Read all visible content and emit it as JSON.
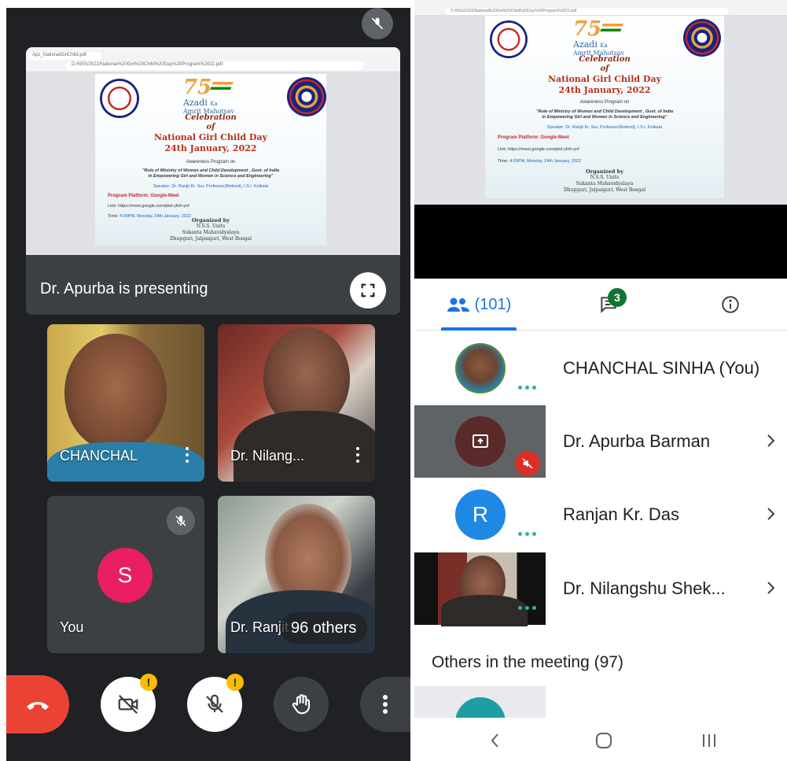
{
  "left": {
    "browser": {
      "tab": "Apz_NationalGirlChild.pdf",
      "url": "D:/NSS/2022/National%20Girl%20Child%20Day%20Program%2022.pdf"
    },
    "presenting_label": "Dr. Apurba is presenting",
    "tiles": [
      {
        "name": "CHANCHAL"
      },
      {
        "name": "Dr. Nilang..."
      },
      {
        "name": "You",
        "initial": "S"
      },
      {
        "name": "Dr. Ranjit Kr. Sur"
      }
    ],
    "others_pill": "96 others",
    "controls": {
      "cam_badge": "!",
      "mic_badge": "!"
    }
  },
  "poster": {
    "azadi_number": "75",
    "azadi_line1": "Azadi",
    "azadi_ka": "Ka",
    "azadi_line2": "Amrit Mahotsav",
    "celebration": "Celebration",
    "of": "of",
    "event": "National Girl Child Day",
    "date": "24th January, 2022",
    "awareness": "Awareness Program on",
    "topic1": "\"Role of Ministry of Women and Child Development , Govt. of India",
    "topic2": "in Empowering Girl and Women in Science and Engineering\"",
    "speaker": "Speaker: Dr. Ranjit Kr. Sur, Professor(Retired), I.S.I. Kolkata",
    "platform": "Program Platform: Google-Meet",
    "link": "Link: https://meet.google.com/pkd-yfoh-ynf",
    "time_label": "Time: ",
    "time_value": "4:00PM, Monday, 24th January, 2022",
    "org1": "Organized by",
    "org2": "N.S.S. Units",
    "org3": "Sukanta Mahavidyalaya",
    "org4": "Dhupguri, Jalpaiguri, West Bengal"
  },
  "right": {
    "url": "D:/NSS/2022/National%20Girl%20Child%20Day%20Program%2022.pdf",
    "tabs": {
      "people_count": "(101)",
      "chat_badge": "3"
    },
    "participants": [
      {
        "name": "CHANCHAL SINHA (You)"
      },
      {
        "name": "Dr. Apurba Barman"
      },
      {
        "name": "Ranjan Kr. Das",
        "initial": "R"
      },
      {
        "name": "Dr. Nilangshu Shek..."
      }
    ],
    "others_label": "Others in the meeting (97)"
  },
  "colors": {
    "meet_dark": "#202124",
    "tile_dark": "#3c4043",
    "end_call_red": "#ea4335",
    "accent_blue": "#1a73e8",
    "badge_yellow": "#fbbc04",
    "chat_green": "#137333",
    "dots_teal": "#2bb3a6",
    "avatar_pink": "#e91e63"
  }
}
